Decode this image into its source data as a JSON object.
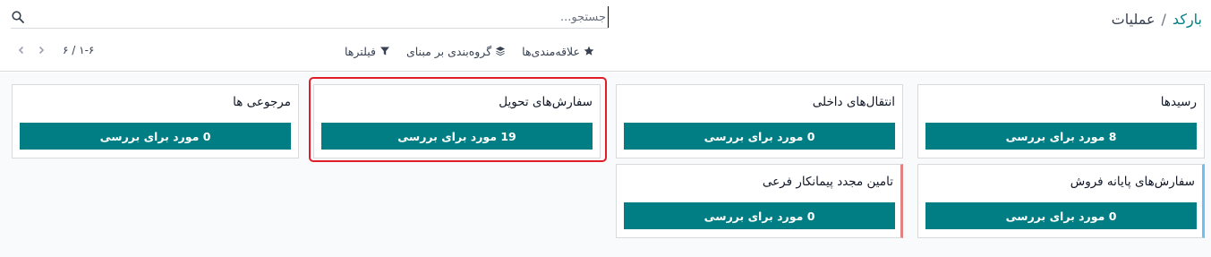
{
  "breadcrumb": {
    "parent": "بارکد",
    "separator": "/",
    "current": "عملیات"
  },
  "search": {
    "placeholder": "جستجو...",
    "icon": "search-icon"
  },
  "filters": {
    "filters_label": "فیلترها",
    "groupby_label": "گروه‌بندی بر مبنای",
    "favorites_label": "علاقه‌مندی‌ها"
  },
  "pager": {
    "value": "۱-۶ / ۶"
  },
  "cards": [
    {
      "title": "رسیدها",
      "button": "8 مورد برای بررسی"
    },
    {
      "title": "انتقال‌های داخلی",
      "button": "0 مورد برای بررسی"
    },
    {
      "title": "سفارش‌های تحویل",
      "button": "19 مورد برای بررسی"
    },
    {
      "title": "مرجوعی ها",
      "button": "0 مورد برای بررسی"
    },
    {
      "title": "سفارش‌های پایانه فروش",
      "button": "0 مورد برای بررسی"
    },
    {
      "title": "تامین مجدد پیمانکار فرعی",
      "button": "0 مورد برای بررسی"
    }
  ],
  "colors": {
    "accent": "#017e84",
    "highlight": "#e11d2a",
    "card_stripe_blue": "#6cc1ed",
    "card_stripe_red": "#e38080"
  }
}
